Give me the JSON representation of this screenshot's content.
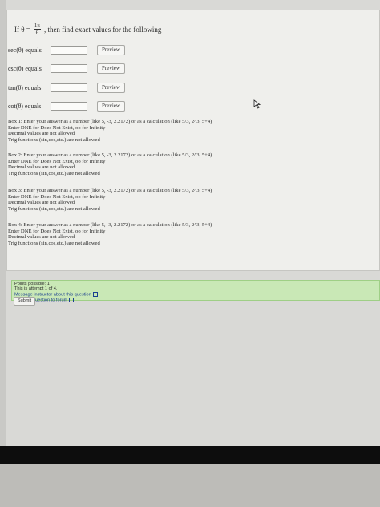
{
  "problem": {
    "intro_prefix": "If θ =",
    "theta_numerator": "1π",
    "theta_denominator": "6",
    "intro_suffix": ", then find exact values for the following"
  },
  "rows": [
    {
      "label": "sec(θ) equals",
      "value": "",
      "preview_label": "Preview"
    },
    {
      "label": "csc(θ) equals",
      "value": "",
      "preview_label": "Preview"
    },
    {
      "label": "tan(θ) equals",
      "value": "",
      "preview_label": "Preview"
    },
    {
      "label": "cot(θ) equals",
      "value": "",
      "preview_label": "Preview"
    }
  ],
  "instructions": [
    {
      "line1": "Box 1: Enter your answer as a number (like 5, -3, 2.2172) or as a calculation (like 5/3, 2^3, 5+4)",
      "line2": "Enter DNE for Does Not Exist, oo for Infinity",
      "line3": "Decimal values are not allowed",
      "line4": "Trig functions (sin,cos,etc.) are not allowed"
    },
    {
      "line1": "Box 2: Enter your answer as a number (like 5, -3, 2.2172) or as a calculation (like 5/3, 2^3, 5+4)",
      "line2": "Enter DNE for Does Not Exist, oo for Infinity",
      "line3": "Decimal values are not allowed",
      "line4": "Trig functions (sin,cos,etc.) are not allowed"
    },
    {
      "line1": "Box 3: Enter your answer as a number (like 5, -3, 2.2172) or as a calculation (like 5/3, 2^3, 5+4)",
      "line2": "Enter DNE for Does Not Exist, oo for Infinity",
      "line3": "Decimal values are not allowed",
      "line4": "Trig functions (sin,cos,etc.) are not allowed"
    },
    {
      "line1": "Box 4: Enter your answer as a number (like 5, -3, 2.2172) or as a calculation (like 5/3, 2^3, 5+4)",
      "line2": "Enter DNE for Does Not Exist, oo for Infinity",
      "line3": "Decimal values are not allowed",
      "line4": "Trig functions (sin,cos,etc.) are not allowed"
    }
  ],
  "status": {
    "points": "Points possible: 1",
    "attempt": "This is attempt 1 of 4.",
    "message_link": "Message instructor about this question",
    "forum_link": "Post this question to forum"
  },
  "submit_label": "Submit",
  "colors": {
    "status_bg": "#c9e8b6",
    "link": "#1b3f8f"
  }
}
